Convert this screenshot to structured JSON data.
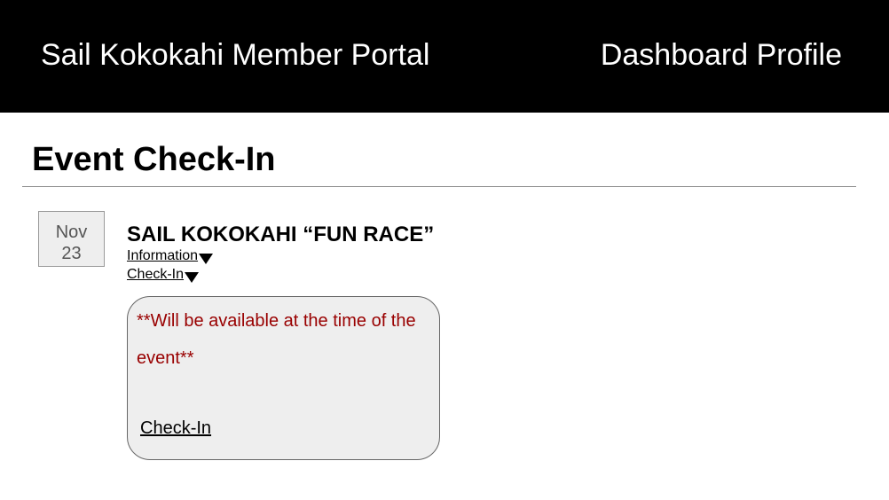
{
  "header": {
    "app_title": "Sail Kokokahi Member Portal",
    "nav": [
      {
        "label": "Dashboard"
      },
      {
        "label": "Profile"
      }
    ]
  },
  "page": {
    "title": "Event Check-In"
  },
  "event": {
    "date": {
      "month": "Nov",
      "day": "23"
    },
    "title": "SAIL KOKOKAHI “FUN RACE”",
    "links": {
      "information": "Information",
      "check_in": "Check-In"
    },
    "checkin_panel": {
      "message": "**Will be available at the time of the event**",
      "link_label": "Check-In"
    }
  },
  "colors": {
    "header_bg": "#000000",
    "header_text": "#ffffff",
    "panel_bg": "#eeeeee",
    "message_text": "#990000"
  },
  "icons": {
    "expand": "triangle-down-icon"
  }
}
